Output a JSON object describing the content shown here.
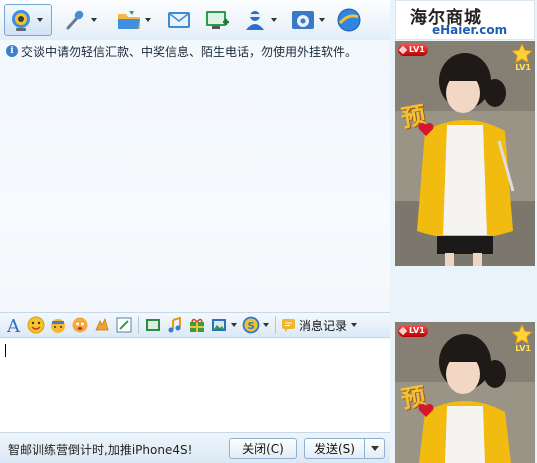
{
  "toolbar": {
    "buttons": [
      {
        "name": "video-call",
        "icon": "webcam-icon",
        "active": true
      },
      {
        "name": "voice-call",
        "icon": "microphone-icon"
      },
      {
        "name": "send-file",
        "icon": "folder-icon"
      },
      {
        "name": "send-email",
        "icon": "envelope-icon"
      },
      {
        "name": "create-group",
        "icon": "add-screen-icon"
      },
      {
        "name": "remote-assist",
        "icon": "remote-user-icon"
      },
      {
        "name": "app-settings",
        "icon": "settings-window-icon"
      },
      {
        "name": "qq-apps",
        "icon": "globe-icon"
      }
    ]
  },
  "notice": {
    "text": "交谈中请勿轻信汇款、中奖信息、陌生电话，勿使用外挂软件。"
  },
  "format_bar": {
    "icons": [
      "font-icon",
      "emoji-icon",
      "magic-expression-icon",
      "funny-face-icon",
      "nudge-icon",
      "doodle-icon",
      "screenshot-icon",
      "music-icon",
      "gift-icon",
      "image-icon",
      "qq-coin-icon"
    ],
    "msglog_label": "消息记录"
  },
  "input": {
    "value": ""
  },
  "bottom": {
    "promo": "智邮训练营倒计时,加推iPhone4S!",
    "close_label": "关闭(C)",
    "send_label": "发送(S)"
  },
  "ad": {
    "title_cn": "海尔商城",
    "title_en": "eHaier.com"
  },
  "profile": {
    "level_badge": "LV1",
    "star_level": "LV1",
    "stamp": "预"
  }
}
